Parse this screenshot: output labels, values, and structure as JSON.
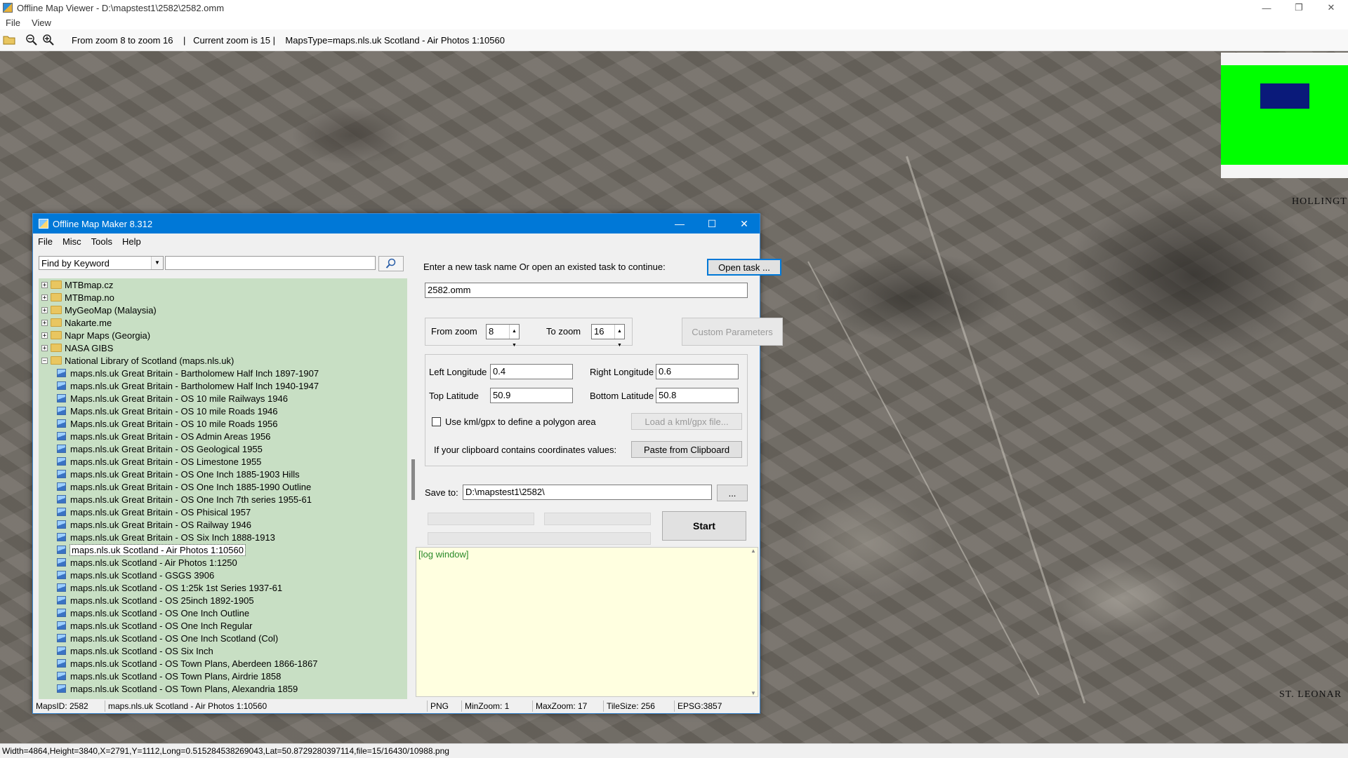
{
  "viewer": {
    "title": "Offline Map Viewer - D:\\mapstest1\\2582\\2582.omm",
    "menu": [
      "File",
      "View"
    ],
    "toolbar_info": "From zoom 8 to zoom 16    |   Current zoom is 15 |    MapsType=maps.nls.uk Scotland - Air Photos 1:10560",
    "window_controls": {
      "minimize": "—",
      "maximize": "❐",
      "close": "✕"
    },
    "map_labels": [
      "HOLLINGT",
      "ST. LEONAR"
    ],
    "overview_colors": {
      "frame": "#00ff00",
      "viewport": "#0a1a7a"
    },
    "status": "Width=4864,Height=3840,X=2791,Y=1112,Long=0.515284538269043,Lat=50.8729280397114,file=15/16430/10988.png"
  },
  "dialog": {
    "title": "Offline Map Maker 8.312",
    "window_controls": {
      "minimize": "—",
      "maximize": "☐",
      "close": "✕"
    },
    "menu": [
      "File",
      "Misc",
      "Tools",
      "Help"
    ],
    "search": {
      "mode": "Find by Keyword",
      "query": "",
      "button_icon": "search-icon"
    },
    "tree": {
      "folders": [
        {
          "label": "MTBmap.cz",
          "expanded": false
        },
        {
          "label": "MTBmap.no",
          "expanded": false
        },
        {
          "label": "MyGeoMap (Malaysia)",
          "expanded": false
        },
        {
          "label": "Nakarte.me",
          "expanded": false
        },
        {
          "label": "Napr Maps (Georgia)",
          "expanded": false
        },
        {
          "label": "NASA GIBS",
          "expanded": false
        },
        {
          "label": "National Library of Scotland (maps.nls.uk)",
          "expanded": true
        }
      ],
      "items": [
        "maps.nls.uk Great Britain - Bartholomew Half Inch 1897-1907",
        "maps.nls.uk Great Britain - Bartholomew Half Inch 1940-1947",
        "Maps.nls.uk Great Britain - OS 10 mile Railways 1946",
        "Maps.nls.uk Great Britain - OS 10 mile Roads 1946",
        "Maps.nls.uk Great Britain - OS 10 mile Roads 1956",
        "maps.nls.uk Great Britain - OS Admin Areas 1956",
        "maps.nls.uk Great Britain - OS Geological 1955",
        "maps.nls.uk Great Britain - OS Limestone 1955",
        "maps.nls.uk Great Britain - OS One Inch 1885-1903 Hills",
        "maps.nls.uk Great Britain - OS One Inch 1885-1990 Outline",
        "maps.nls.uk Great Britain - OS One Inch 7th series 1955-61",
        "maps.nls.uk Great Britain - OS Phisical 1957",
        "maps.nls.uk Great Britain - OS Railway 1946",
        "maps.nls.uk Great Britain - OS Six Inch 1888-1913",
        "maps.nls.uk Scotland - Air Photos 1:10560",
        "maps.nls.uk Scotland - Air Photos 1:1250",
        "maps.nls.uk Scotland - GSGS 3906",
        "maps.nls.uk Scotland - OS 1:25k 1st Series 1937-61",
        "maps.nls.uk Scotland - OS 25inch 1892-1905",
        "maps.nls.uk Scotland - OS One Inch Outline",
        "maps.nls.uk Scotland - OS One Inch Regular",
        "maps.nls.uk Scotland - OS One Inch Scotland (Col)",
        "maps.nls.uk Scotland - OS Six Inch",
        "maps.nls.uk Scotland - OS Town Plans, Aberdeen 1866-1867",
        "maps.nls.uk Scotland - OS Town Plans, Airdrie 1858",
        "maps.nls.uk Scotland - OS Town Plans, Alexandria 1859"
      ],
      "selected_index": 14
    },
    "task": {
      "prompt": "Enter a new task name Or open an existed task to continue:",
      "open_button": "Open task ...",
      "name": "2582.omm"
    },
    "zoom": {
      "from_label": "From zoom",
      "from_value": "8",
      "to_label": "To zoom",
      "to_value": "16",
      "custom_button": "Custom Parameters"
    },
    "coords": {
      "left_lon_label": "Left Longitude",
      "left_lon": "0.4",
      "right_lon_label": "Right Longitude",
      "right_lon": "0.6",
      "top_lat_label": "Top Latitude",
      "top_lat": "50.9",
      "bottom_lat_label": "Bottom Latitude",
      "bottom_lat": "50.8",
      "kml_label": "Use kml/gpx to define a polygon area",
      "kml_checked": false,
      "kml_button": "Load a kml/gpx file...",
      "clipboard_label": "If your clipboard contains coordinates values:",
      "clipboard_button": "Paste from Clipboard"
    },
    "save": {
      "label": "Save to:",
      "path": "D:\\mapstest1\\2582\\",
      "browse": "...",
      "start": "Start"
    },
    "log": "[log window]",
    "status": {
      "maps_id": "MapsID: 2582",
      "maps_name": "maps.nls.uk Scotland - Air Photos 1:10560",
      "format": "PNG",
      "min_zoom": "MinZoom: 1",
      "max_zoom": "MaxZoom: 17",
      "tile_size": "TileSize: 256",
      "epsg": "EPSG:3857"
    }
  }
}
